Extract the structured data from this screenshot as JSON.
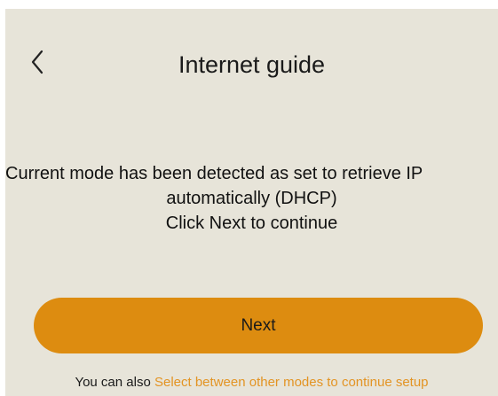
{
  "header": {
    "back_icon": "chevron-left-icon",
    "title": "Internet guide"
  },
  "message": {
    "line1": "Current mode has been detected as set to retrieve IP",
    "line2": "automatically (DHCP)",
    "line3": "Click Next to continue"
  },
  "actions": {
    "next_label": "Next"
  },
  "footer": {
    "prefix": "You can also ",
    "link_text": "Select between other modes to continue setup"
  },
  "colors": {
    "background": "#e7e4d9",
    "accent": "#dd8c10",
    "link": "#e39424"
  }
}
